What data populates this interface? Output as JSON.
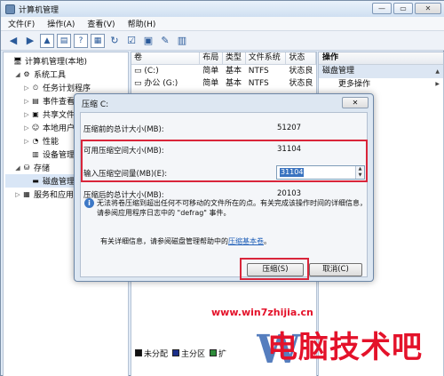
{
  "window": {
    "title": "计算机管理",
    "controls": [
      "—",
      "▭",
      "✕"
    ]
  },
  "menu": [
    "文件(F)",
    "操作(A)",
    "查看(V)",
    "帮助(H)"
  ],
  "tree": [
    {
      "label": "计算机管理(本地)",
      "level": 0,
      "icon": "computer-icon",
      "glyph": "🖥",
      "exp": ""
    },
    {
      "label": "系统工具",
      "level": 1,
      "icon": "tools-icon",
      "glyph": "⚙",
      "exp": "◢"
    },
    {
      "label": "任务计划程序",
      "level": 2,
      "icon": "clock-icon",
      "glyph": "⏲",
      "exp": "▷"
    },
    {
      "label": "事件查看器",
      "level": 2,
      "icon": "event-icon",
      "glyph": "▤",
      "exp": "▷"
    },
    {
      "label": "共享文件夹",
      "level": 2,
      "icon": "folder-icon",
      "glyph": "▣",
      "exp": "▷"
    },
    {
      "label": "本地用户和组",
      "level": 2,
      "icon": "users-icon",
      "glyph": "☺",
      "exp": "▷"
    },
    {
      "label": "性能",
      "level": 2,
      "icon": "performance-icon",
      "glyph": "◔",
      "exp": "▷"
    },
    {
      "label": "设备管理器",
      "level": 2,
      "icon": "device-icon",
      "glyph": "▥",
      "exp": ""
    },
    {
      "label": "存储",
      "level": 1,
      "icon": "storage-icon",
      "glyph": "⛁",
      "exp": "◢"
    },
    {
      "label": "磁盘管理",
      "level": 2,
      "icon": "disk-icon",
      "glyph": "▬",
      "exp": ""
    },
    {
      "label": "服务和应用程序",
      "level": 1,
      "icon": "services-icon",
      "glyph": "▦",
      "exp": "▷"
    }
  ],
  "list": {
    "columns": [
      "卷",
      "布局",
      "类型",
      "文件系统",
      "状态"
    ],
    "rows": [
      [
        "(C:)",
        "简单",
        "基本",
        "NTFS",
        "状态良"
      ],
      [
        "办公 (G:)",
        "简单",
        "基本",
        "NTFS",
        "状态良"
      ]
    ],
    "legend": [
      {
        "label": "未分配",
        "color": "#111111"
      },
      {
        "label": "主分区",
        "color": "#1b2f8a"
      },
      {
        "label": "扩",
        "color": "#2e8b3a"
      }
    ]
  },
  "actions": {
    "header": "操作",
    "section": "磁盘管理",
    "item": "更多操作"
  },
  "dialog": {
    "title": "压缩 C:",
    "close": "✕",
    "fields": [
      {
        "label": "压缩前的总计大小(MB):",
        "value": "51207"
      },
      {
        "label": "可用压缩空间大小(MB):",
        "value": "31104"
      },
      {
        "label": "输入压缩空间量(MB)(E):",
        "value": "31104"
      },
      {
        "label": "压缩后的总计大小(MB):",
        "value": "20103"
      }
    ],
    "info": "无法将卷压缩到超出任何不可移动的文件所在的点。有关完成该操作时间的详细信息，请参阅应用程序日志中的 \"defrag\" 事件。",
    "more_prefix": "有关详细信息，请参阅磁盘管理帮助中的",
    "more_link": "压缩基本卷",
    "more_suffix": "。",
    "ok": "压缩(S)",
    "cancel": "取消(C)"
  },
  "watermark": {
    "url": "www.win7zhijia.cn",
    "brand": "电脑技术吧"
  },
  "colors": {
    "highlight": "#d9253a",
    "watermark": "#e4122a",
    "selection": "#3a73c0"
  }
}
